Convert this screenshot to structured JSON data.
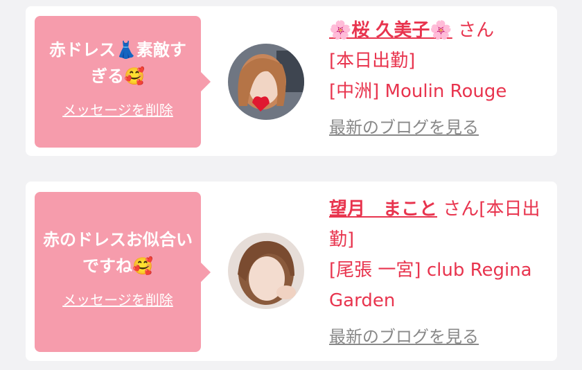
{
  "messages": [
    {
      "text": "赤ドレス👗素敵すぎる🥰",
      "delete_label": "メッセージを削除",
      "name": "🌸桜 久美子🌸",
      "honorific": "さん",
      "status": "[本日出勤]",
      "shop": "[中洲] Moulin Rouge",
      "blog_label": "最新のブログを見る"
    },
    {
      "text": "赤のドレスお似合いですね🥰",
      "delete_label": "メッセージを削除",
      "name": "望月　まこと",
      "honorific": "さん",
      "status": "[本日出勤]",
      "shop": "[尾張 一宮] club Regina Garden",
      "blog_label": "最新のブログを見る"
    }
  ],
  "colors": {
    "bubble": "#f69cac",
    "accent": "#e8344e",
    "muted": "#888888",
    "background": "#f2f2f4"
  }
}
